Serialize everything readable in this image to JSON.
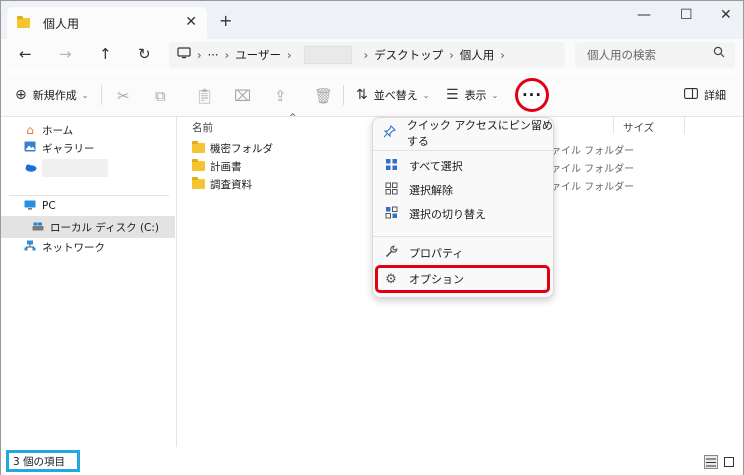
{
  "window": {
    "tab_title": "個人用",
    "tab_close": "✕",
    "new_tab": "+",
    "minimize": "—",
    "maximize": "☐",
    "close": "✕"
  },
  "nav": {
    "back": "←",
    "forward": "→",
    "up": "↑",
    "refresh": "↻"
  },
  "address": {
    "pc_icon": "monitor-icon",
    "sep": "›",
    "overflow": "···",
    "crumbs": [
      "ユーザー",
      "デスクトップ",
      "個人用"
    ]
  },
  "search": {
    "placeholder": "個人用の検索",
    "icon": "search-icon"
  },
  "toolbar": {
    "new_label": "新規作成",
    "sort_label": "並べ替え",
    "view_label": "表示",
    "more_label": "···",
    "details_label": "詳細"
  },
  "sidebar": {
    "items": [
      {
        "label": "ホーム",
        "icon": "home-icon"
      },
      {
        "label": "ギャラリー",
        "icon": "gallery-icon"
      },
      {
        "label": "",
        "icon": "cloud-icon"
      },
      {
        "label": "PC",
        "icon": "pc-icon"
      },
      {
        "label": "ローカル ディスク (C:)",
        "icon": "drive-icon"
      },
      {
        "label": "ネットワーク",
        "icon": "network-icon"
      }
    ]
  },
  "columns": {
    "name": "名前",
    "size": "サイズ"
  },
  "files": [
    {
      "name": "機密フォルダ",
      "type": "ァイル フォルダー"
    },
    {
      "name": "計画書",
      "type": "ァイル フォルダー"
    },
    {
      "name": "調査資料",
      "type": "ァイル フォルダー"
    }
  ],
  "menu": {
    "pin": "クイック アクセスにピン留めする",
    "select_all": "すべて選択",
    "deselect": "選択解除",
    "invert": "選択の切り替え",
    "properties": "プロパティ",
    "options": "オプション"
  },
  "status": {
    "item_count": "3 個の項目"
  },
  "colors": {
    "highlight_red": "#e00012",
    "highlight_blue": "#23a6e2",
    "folder_yellow": "#f5c431"
  }
}
